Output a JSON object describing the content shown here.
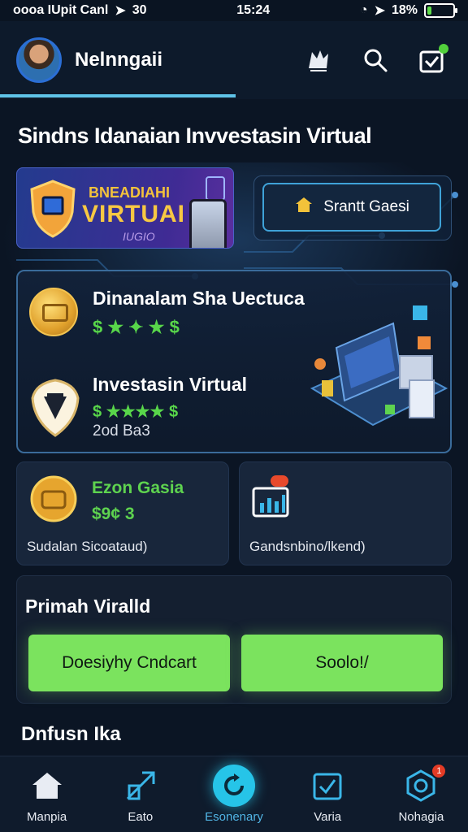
{
  "status_bar": {
    "carrier": "ᴏᴏᴏa IUpit Canl",
    "time": "15:24",
    "battery": "18%",
    "battery_level": 0.18,
    "network_label": "30"
  },
  "header": {
    "username": "Nelnngaii",
    "icons": [
      "wolf-icon",
      "search-icon",
      "checkmark-box-icon"
    ]
  },
  "page_title": "Sindns Idanaian Invvestasin Virtual",
  "promo": {
    "line1": "BNEADIAHI",
    "line2": "VIRTUAI",
    "line3": "IUGIO",
    "button_label": "Srantt Gaesi"
  },
  "combo_card": {
    "item1_title": "Dinanalam Sha Uectuca",
    "item1_stars": "$ ★ ✦ ★ $",
    "item2_title": "Investasin Virtual",
    "item2_stars": "$ ★★★★ $",
    "item2_count": "2od Ba3"
  },
  "small_cards": {
    "left_title": "Ezon Gasia",
    "left_value": "$9¢ 3",
    "left_caption": "Sudalan Sicoataud)",
    "right_caption": "Gandsnbino/lkend)"
  },
  "premium": {
    "title": "Primah Viralld",
    "button_left": "Doesiyhy Cndcart",
    "button_right": "Soolo!/"
  },
  "section_label": "Dnfusn Ika",
  "bottom_nav": {
    "items": [
      {
        "label": "Manpia",
        "icon": "home-icon"
      },
      {
        "label": "Eato",
        "icon": "trend-arrow-icon"
      },
      {
        "label": "Esonenary",
        "icon": "refresh-icon"
      },
      {
        "label": "Varia",
        "icon": "checkbox-icon"
      },
      {
        "label": "Nohagia",
        "icon": "hexagon-icon"
      }
    ],
    "active_index": 2,
    "badge_count": "1"
  },
  "colors": {
    "accent_green": "#7be35e",
    "accent_cyan": "#26c4e8",
    "background": "#0b1524"
  }
}
